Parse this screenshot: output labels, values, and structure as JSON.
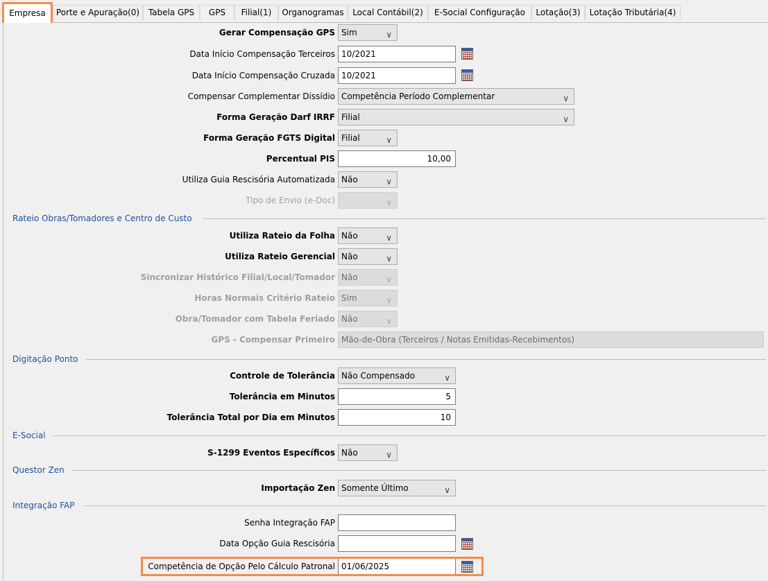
{
  "tabs": [
    {
      "label": "Empresa",
      "active": true
    },
    {
      "label": "Porte e Apuração(0)"
    },
    {
      "label": "Tabela GPS"
    },
    {
      "label": "GPS"
    },
    {
      "label": "Filial(1)"
    },
    {
      "label": "Organogramas"
    },
    {
      "label": "Local Contábil(2)"
    },
    {
      "label": "E-Social Configuração"
    },
    {
      "label": "Lotação(3)"
    },
    {
      "label": "Lotação Tributária(4)"
    }
  ],
  "icons": {
    "chevron": "chevron-down-icon",
    "calendar": "calendar-icon"
  },
  "colors": {
    "accent": "#f58b45",
    "section": "#1e4f9c"
  },
  "empresa": {
    "gerar_compensacao_gps": {
      "label": "Gerar Compensação GPS",
      "value": "Sim"
    },
    "data_inicio_comp_terceiros": {
      "label": "Data Início Compensação Terceiros",
      "value": "10/2021"
    },
    "data_inicio_comp_cruzada": {
      "label": "Data Início Compensação Cruzada",
      "value": "10/2021"
    },
    "compensar_complementar_dissidio": {
      "label": "Compensar Complementar Dissídio",
      "value": "Competência Período Complementar"
    },
    "forma_geracao_darf_irrf": {
      "label": "Forma Geração Darf IRRF",
      "value": "Filial"
    },
    "forma_geracao_fgts_digital": {
      "label": "Forma Geração FGTS Digital",
      "value": "Filial"
    },
    "percentual_pis": {
      "label": "Percentual PIS",
      "value": "10,00"
    },
    "utiliza_guia_rescisoria": {
      "label": "Utiliza Guia Rescisória Automatizada",
      "value": "Não"
    },
    "tipo_envio_edoc": {
      "label": "Tipo de Envio (e-Doc)",
      "value": ""
    }
  },
  "rateio": {
    "title": "Rateio Obras/Tomadores e Centro de Custo",
    "utiliza_rateio_folha": {
      "label": "Utiliza Rateio da Folha",
      "value": "Não"
    },
    "utiliza_rateio_gerencial": {
      "label": "Utiliza Rateio Gerencial",
      "value": "Não"
    },
    "sincronizar_historico": {
      "label": "Sincronizar Histórico Filial/Local/Tomador",
      "value": "Não"
    },
    "horas_normais_criterio": {
      "label": "Horas Normais Critério Rateio",
      "value": "Sim"
    },
    "obra_tomador_feriado": {
      "label": "Obra/Tomador com Tabela Feriado",
      "value": "Não"
    },
    "gps_compensar_primeiro": {
      "label": "GPS - Compensar Primeiro",
      "value": "Mão-de-Obra (Terceiros / Notas Emitidas-Recebimentos)"
    }
  },
  "ponto": {
    "title": "Digitação Ponto",
    "controle_tolerancia": {
      "label": "Controle de Tolerância",
      "value": "Não Compensado"
    },
    "tolerancia_minutos": {
      "label": "Tolerância em Minutos",
      "value": "5"
    },
    "tolerancia_total_dia": {
      "label": "Tolerância Total por Dia em Minutos",
      "value": "10"
    }
  },
  "esocial": {
    "title": "E-Social",
    "s1299_eventos": {
      "label": "S-1299 Eventos Específicos",
      "value": "Não"
    }
  },
  "questor": {
    "title": "Questor Zen",
    "importacao_zen": {
      "label": "Importação Zen",
      "value": "Somente Último"
    }
  },
  "fap": {
    "title": "Integração FAP",
    "senha_integracao": {
      "label": "Senha Integração FAP",
      "value": ""
    },
    "data_opcao_guia": {
      "label": "Data Opção Guia Rescisória",
      "value": ""
    },
    "competencia_calculo_patronal": {
      "label": "Competência de Opção Pelo Cálculo Patronal",
      "value": "01/06/2025"
    }
  }
}
